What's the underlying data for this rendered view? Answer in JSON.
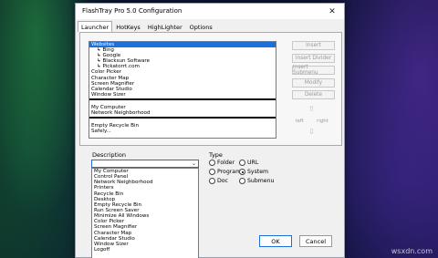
{
  "window": {
    "title": "FlashTray Pro 5.0 Configuration",
    "close_glyph": "✕"
  },
  "tabs": [
    "Launcher",
    "HotKeys",
    "HighLighter",
    "Options"
  ],
  "launcher_list": {
    "items": [
      "Websites",
      "↳ Bing",
      "↳ Google",
      "↳ Blacksun Software",
      "↳ Pickatorrt.com",
      "Color Picker",
      "Character Map",
      "Screen Magnifier",
      "Calendar Studio",
      "Window Sizer"
    ],
    "group2": [
      "My Computer",
      "Network Neighborhood"
    ],
    "group3": [
      "Empty Recycle Bin",
      "Safely..."
    ],
    "selected_index": 0
  },
  "side_buttons": {
    "insert": "Insert",
    "insert_divider": "Insert Divider",
    "insert_submenu": "Insert Submenu",
    "modify": "Modify",
    "delete": "Delete",
    "left": "left",
    "right": "right"
  },
  "icons": {
    "up": "⇧",
    "down": "⇩",
    "left": "⇦",
    "right": "⇨",
    "combo": "⌄"
  },
  "description": {
    "label": "Description",
    "value": "",
    "options": [
      "My Computer",
      "Control Panel",
      "Network Neighborhood",
      "Printers",
      "Recycle Bin",
      "Desktop",
      "Empty Recycle Bin",
      "Run Screen Saver",
      "Minimize All Windows",
      "Color Picker",
      "Screen Magnifier",
      "Character Map",
      "Calendar Studio",
      "Window Sizer",
      "Logoff"
    ]
  },
  "type": {
    "label": "Type",
    "options": {
      "folder": "Folder",
      "url": "URL",
      "program": "Program",
      "system": "System",
      "doc": "Doc",
      "submenu": "Submenu"
    },
    "selected": "System"
  },
  "buttons": {
    "ok": "OK",
    "cancel": "Cancel"
  },
  "watermark": "wsxdn.com"
}
